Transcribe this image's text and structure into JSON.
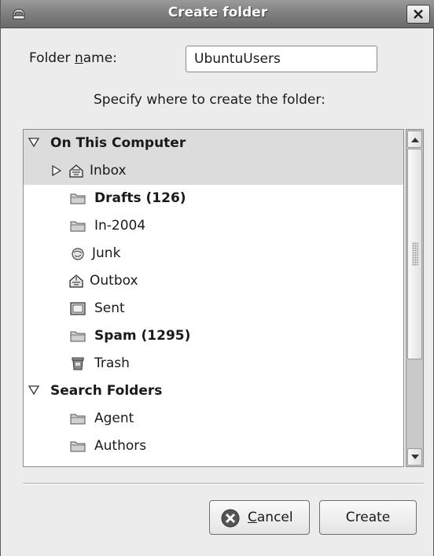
{
  "window": {
    "title": "Create folder"
  },
  "form": {
    "name_label_pre": "Folder ",
    "name_label_mnemonic": "n",
    "name_label_post": "ame:",
    "name_value": "UbuntuUsers",
    "instruction": "Specify where to create the folder:"
  },
  "tree": {
    "groups": [
      {
        "label": "On This Computer",
        "expanded": true
      },
      {
        "label": "Search Folders",
        "expanded": true
      }
    ],
    "items": [
      {
        "label": "Inbox",
        "icon": "inbox-icon",
        "bold": false,
        "selected": true,
        "has_children": true
      },
      {
        "label": "Drafts (126)",
        "icon": "folder-icon",
        "bold": true
      },
      {
        "label": "In-2004",
        "icon": "folder-icon",
        "bold": false
      },
      {
        "label": "Junk",
        "icon": "junk-icon",
        "bold": false
      },
      {
        "label": "Outbox",
        "icon": "outbox-icon",
        "bold": false
      },
      {
        "label": "Sent",
        "icon": "sent-icon",
        "bold": false
      },
      {
        "label": "Spam (1295)",
        "icon": "folder-icon",
        "bold": true
      },
      {
        "label": "Trash",
        "icon": "trash-icon",
        "bold": false
      },
      {
        "label": "Agent",
        "icon": "folder-icon",
        "bold": false
      },
      {
        "label": "Authors",
        "icon": "folder-icon",
        "bold": false
      }
    ]
  },
  "buttons": {
    "cancel_mnemonic": "C",
    "cancel_rest": "ancel",
    "create": "Create"
  }
}
